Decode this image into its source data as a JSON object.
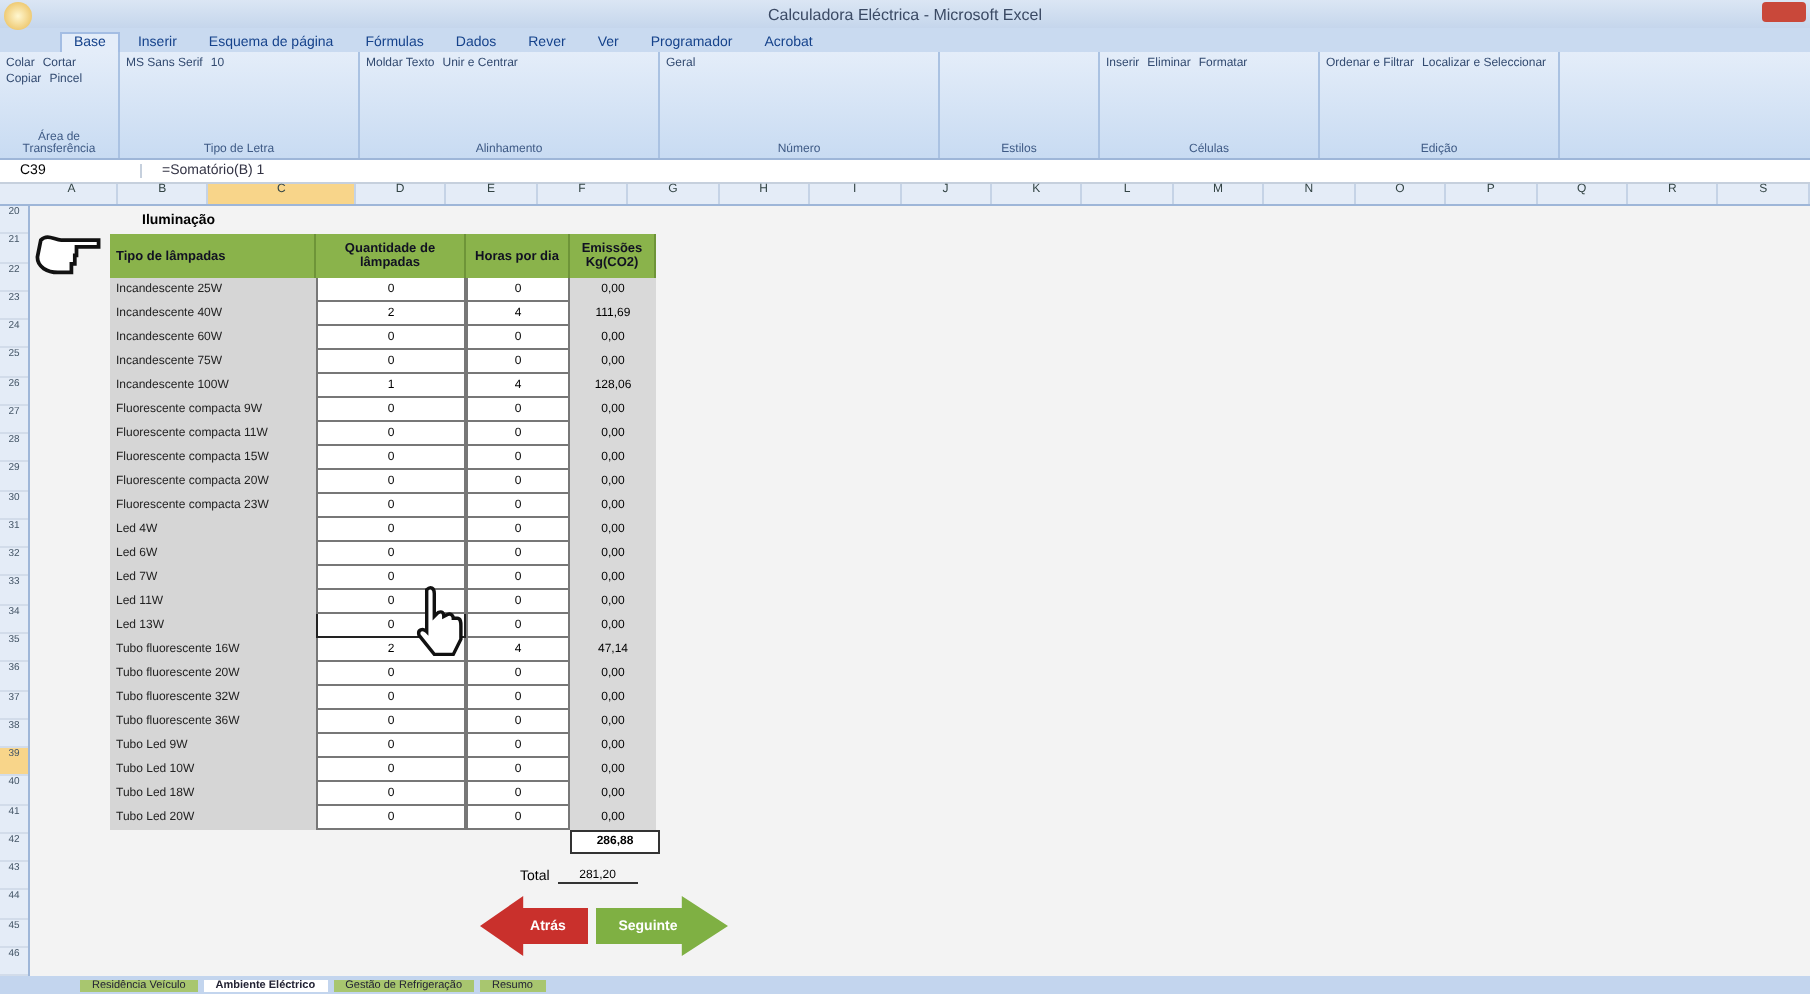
{
  "window": {
    "title": "Calculadora Eléctrica - Microsoft Excel"
  },
  "ribbon_tabs": [
    {
      "label": "Base",
      "selected": true
    },
    {
      "label": "Inserir",
      "selected": false
    },
    {
      "label": "Esquema de página",
      "selected": false
    },
    {
      "label": "Fórmulas",
      "selected": false
    },
    {
      "label": "Dados",
      "selected": false
    },
    {
      "label": "Rever",
      "selected": false
    },
    {
      "label": "Ver",
      "selected": false
    },
    {
      "label": "Programador",
      "selected": false
    },
    {
      "label": "Acrobat",
      "selected": false
    }
  ],
  "ribbon_groups": [
    {
      "label": "Área de Transferência",
      "items": [
        "Colar",
        "Cortar",
        "Copiar",
        "Pincel"
      ]
    },
    {
      "label": "Tipo de Letra",
      "items": [
        "MS Sans Serif",
        "10"
      ]
    },
    {
      "label": "Alinhamento",
      "items": [
        "Moldar Texto",
        "Unir e Centrar"
      ]
    },
    {
      "label": "Número",
      "items": [
        "Geral"
      ]
    },
    {
      "label": "Estilos"
    },
    {
      "label": "Células",
      "items": [
        "Inserir",
        "Eliminar",
        "Formatar"
      ]
    },
    {
      "label": "Edição",
      "items": [
        "Ordenar e Filtrar",
        "Localizar e Seleccionar"
      ]
    }
  ],
  "formula_bar": {
    "name_box": "C39",
    "formula": "=Somatório(B) 1"
  },
  "columns": [
    {
      "label": "A",
      "selected": false
    },
    {
      "label": "B",
      "selected": false
    },
    {
      "label": "C",
      "selected": true
    },
    {
      "label": "D",
      "selected": false
    },
    {
      "label": "E",
      "selected": false
    },
    {
      "label": "F",
      "selected": false
    },
    {
      "label": "G",
      "selected": false
    },
    {
      "label": "H",
      "selected": false
    },
    {
      "label": "I",
      "selected": false
    },
    {
      "label": "J",
      "selected": false
    },
    {
      "label": "K",
      "selected": false
    },
    {
      "label": "L",
      "selected": false
    },
    {
      "label": "M",
      "selected": false
    },
    {
      "label": "N",
      "selected": false
    },
    {
      "label": "O",
      "selected": false
    },
    {
      "label": "P",
      "selected": false
    },
    {
      "label": "Q",
      "selected": false
    },
    {
      "label": "R",
      "selected": false
    },
    {
      "label": "S",
      "selected": false
    }
  ],
  "row_numbers": [
    {
      "label": "20",
      "selected": false
    },
    {
      "label": "21",
      "selected": false
    },
    {
      "label": "22",
      "selected": false
    },
    {
      "label": "23",
      "selected": false
    },
    {
      "label": "24",
      "selected": false
    },
    {
      "label": "25",
      "selected": false
    },
    {
      "label": "26",
      "selected": false
    },
    {
      "label": "27",
      "selected": false
    },
    {
      "label": "28",
      "selected": false
    },
    {
      "label": "29",
      "selected": false
    },
    {
      "label": "30",
      "selected": false
    },
    {
      "label": "31",
      "selected": false
    },
    {
      "label": "32",
      "selected": false
    },
    {
      "label": "33",
      "selected": false
    },
    {
      "label": "34",
      "selected": false
    },
    {
      "label": "35",
      "selected": false
    },
    {
      "label": "36",
      "selected": false
    },
    {
      "label": "37",
      "selected": false
    },
    {
      "label": "38",
      "selected": false
    },
    {
      "label": "39",
      "selected": true
    },
    {
      "label": "40",
      "selected": false
    },
    {
      "label": "41",
      "selected": false
    },
    {
      "label": "42",
      "selected": false
    },
    {
      "label": "43",
      "selected": false
    },
    {
      "label": "44",
      "selected": false
    },
    {
      "label": "45",
      "selected": false
    },
    {
      "label": "46",
      "selected": false
    }
  ],
  "section_title": "Iluminação",
  "table": {
    "columns": [
      "Tipo de lâmpadas",
      "Quantidade de lâmpadas",
      "Horas por dia",
      "Emissões Kg(CO2)"
    ],
    "rows": [
      {
        "type": "Incandescente 25W",
        "qty": "0",
        "hours": "0",
        "emissions": "0,00",
        "selected": false
      },
      {
        "type": "Incandescente 40W",
        "qty": "2",
        "hours": "4",
        "emissions": "111,69",
        "selected": false
      },
      {
        "type": "Incandescente 60W",
        "qty": "0",
        "hours": "0",
        "emissions": "0,00",
        "selected": false
      },
      {
        "type": "Incandescente 75W",
        "qty": "0",
        "hours": "0",
        "emissions": "0,00",
        "selected": false
      },
      {
        "type": "Incandescente 100W",
        "qty": "1",
        "hours": "4",
        "emissions": "128,06",
        "selected": false
      },
      {
        "type": "Fluorescente compacta 9W",
        "qty": "0",
        "hours": "0",
        "emissions": "0,00",
        "selected": false
      },
      {
        "type": "Fluorescente compacta 11W",
        "qty": "0",
        "hours": "0",
        "emissions": "0,00",
        "selected": false
      },
      {
        "type": "Fluorescente compacta 15W",
        "qty": "0",
        "hours": "0",
        "emissions": "0,00",
        "selected": false
      },
      {
        "type": "Fluorescente compacta 20W",
        "qty": "0",
        "hours": "0",
        "emissions": "0,00",
        "selected": false
      },
      {
        "type": "Fluorescente compacta 23W",
        "qty": "0",
        "hours": "0",
        "emissions": "0,00",
        "selected": false
      },
      {
        "type": "Led 4W",
        "qty": "0",
        "hours": "0",
        "emissions": "0,00",
        "selected": false
      },
      {
        "type": "Led 6W",
        "qty": "0",
        "hours": "0",
        "emissions": "0,00",
        "selected": false
      },
      {
        "type": "Led 7W",
        "qty": "0",
        "hours": "0",
        "emissions": "0,00",
        "selected": false
      },
      {
        "type": "Led 11W",
        "qty": "0",
        "hours": "0",
        "emissions": "0,00",
        "selected": false
      },
      {
        "type": "Led 13W",
        "qty": "0",
        "hours": "0",
        "emissions": "0,00",
        "selected": true
      },
      {
        "type": "Tubo fluorescente 16W",
        "qty": "2",
        "hours": "4",
        "emissions": "47,14",
        "selected": false
      },
      {
        "type": "Tubo fluorescente 20W",
        "qty": "0",
        "hours": "0",
        "emissions": "0,00",
        "selected": false
      },
      {
        "type": "Tubo fluorescente 32W",
        "qty": "0",
        "hours": "0",
        "emissions": "0,00",
        "selected": false
      },
      {
        "type": "Tubo fluorescente 36W",
        "qty": "0",
        "hours": "0",
        "emissions": "0,00",
        "selected": false
      },
      {
        "type": "Tubo Led 9W",
        "qty": "0",
        "hours": "0",
        "emissions": "0,00",
        "selected": false
      },
      {
        "type": "Tubo Led 10W",
        "qty": "0",
        "hours": "0",
        "emissions": "0,00",
        "selected": false
      },
      {
        "type": "Tubo Led 18W",
        "qty": "0",
        "hours": "0",
        "emissions": "0,00",
        "selected": false
      },
      {
        "type": "Tubo Led 20W",
        "qty": "0",
        "hours": "0",
        "emissions": "0,00",
        "selected": false
      }
    ],
    "subtotal": "286,88"
  },
  "total": {
    "label": "Total",
    "value": "281,20"
  },
  "buttons": [
    {
      "label": "Atrás",
      "kind": "back"
    },
    {
      "label": "Seguinte",
      "kind": "next"
    }
  ],
  "sheet_tabs": [
    {
      "label": "Residência Veículo",
      "selected": false
    },
    {
      "label": "Ambiente Eléctrico",
      "selected": true
    },
    {
      "label": "Gestão de Refrigeração",
      "selected": false
    },
    {
      "label": "Resumo",
      "selected": false
    }
  ]
}
